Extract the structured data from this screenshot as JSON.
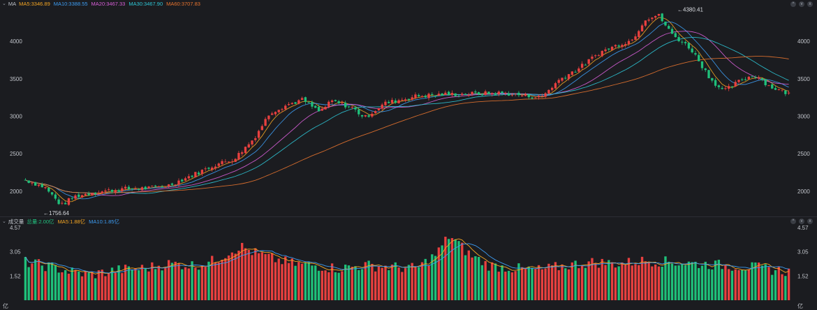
{
  "price_legend": {
    "label": "MA",
    "items": [
      {
        "text": "MA5:3346.89",
        "color": "#f5a623"
      },
      {
        "text": "MA10:3388.55",
        "color": "#3d9df3"
      },
      {
        "text": "MA20:3467.33",
        "color": "#d95fd9"
      },
      {
        "text": "MA30:3467.90",
        "color": "#2ec7d6"
      },
      {
        "text": "MA60:3707.83",
        "color": "#e8742f"
      }
    ]
  },
  "volume_legend": {
    "label": "成交量",
    "items": [
      {
        "text": "总量:2.00亿",
        "color": "#22c07e"
      },
      {
        "text": "MA5:1.88亿",
        "color": "#f5a623"
      },
      {
        "text": "MA10:1.85亿",
        "color": "#3d9df3"
      }
    ]
  },
  "controls": {
    "up_icon": "^",
    "down_icon": "v",
    "close_icon": "x"
  },
  "colors": {
    "up": "#e8403f",
    "down": "#1fc07a"
  },
  "chart_data": [
    {
      "type": "candlestick",
      "ylim": [
        1700,
        4420
      ],
      "y_ticks": [
        2000,
        2500,
        3000,
        3500,
        4000
      ],
      "y_tick_labels": [
        "2000",
        "2500",
        "3000",
        "3500",
        "4000"
      ],
      "grid": false,
      "annotations": [
        {
          "text": "←1756.64",
          "value": 1756.64,
          "position_hint": "low"
        },
        {
          "text": "←4380.41",
          "value": 4380.41,
          "position_hint": "high"
        }
      ],
      "close_path": [
        [
          0,
          2150
        ],
        [
          0.03,
          2050
        ],
        [
          0.055,
          1810
        ],
        [
          0.075,
          1930
        ],
        [
          0.11,
          1990
        ],
        [
          0.15,
          2030
        ],
        [
          0.19,
          2040
        ],
        [
          0.22,
          2080
        ],
        [
          0.26,
          2230
        ],
        [
          0.29,
          2350
        ],
        [
          0.32,
          2430
        ],
        [
          0.35,
          2700
        ],
        [
          0.375,
          3050
        ],
        [
          0.4,
          3150
        ],
        [
          0.425,
          3220
        ],
        [
          0.45,
          3060
        ],
        [
          0.47,
          3200
        ],
        [
          0.5,
          3120
        ],
        [
          0.52,
          2980
        ],
        [
          0.55,
          3170
        ],
        [
          0.6,
          3270
        ],
        [
          0.64,
          3290
        ],
        [
          0.69,
          3300
        ],
        [
          0.73,
          3310
        ],
        [
          0.76,
          3280
        ],
        [
          0.79,
          3250
        ],
        [
          0.82,
          3500
        ],
        [
          0.85,
          3650
        ],
        [
          0.88,
          3850
        ],
        [
          0.91,
          3960
        ],
        [
          0.93,
          4020
        ],
        [
          0.95,
          4300
        ],
        [
          0.97,
          4350
        ],
        [
          0.99,
          4100
        ],
        [
          1.02,
          3900
        ],
        [
          1.05,
          3500
        ],
        [
          1.07,
          3330
        ],
        [
          1.1,
          3500
        ],
        [
          1.12,
          3550
        ],
        [
          1.14,
          3400
        ],
        [
          1.17,
          3300
        ]
      ],
      "series": [
        {
          "name": "MA5",
          "value": 3346.89
        },
        {
          "name": "MA10",
          "value": 3388.55
        },
        {
          "name": "MA20",
          "value": 3467.33
        },
        {
          "name": "MA30",
          "value": 3467.9
        },
        {
          "name": "MA60",
          "value": 3707.83
        }
      ]
    },
    {
      "type": "bar",
      "ylim": [
        0,
        4.57
      ],
      "y_ticks": [
        1.52,
        3.05,
        4.57
      ],
      "y_tick_labels": [
        "1.52",
        "3.05",
        "4.57"
      ],
      "unit_label": "亿",
      "volume_path": [
        [
          0,
          2.4
        ],
        [
          0.04,
          2.1
        ],
        [
          0.07,
          1.8
        ],
        [
          0.1,
          1.6
        ],
        [
          0.14,
          1.9
        ],
        [
          0.18,
          2.0
        ],
        [
          0.22,
          2.3
        ],
        [
          0.26,
          2.2
        ],
        [
          0.29,
          2.5
        ],
        [
          0.31,
          3.0
        ],
        [
          0.33,
          3.4
        ],
        [
          0.35,
          3.0
        ],
        [
          0.38,
          2.6
        ],
        [
          0.41,
          2.3
        ],
        [
          0.44,
          2.2
        ],
        [
          0.48,
          2.0
        ],
        [
          0.52,
          2.2
        ],
        [
          0.56,
          2.1
        ],
        [
          0.6,
          2.0
        ],
        [
          0.63,
          2.9
        ],
        [
          0.65,
          4.1
        ],
        [
          0.68,
          2.9
        ],
        [
          0.71,
          2.2
        ],
        [
          0.75,
          2.0
        ],
        [
          0.79,
          1.9
        ],
        [
          0.83,
          2.2
        ],
        [
          0.87,
          2.4
        ],
        [
          0.91,
          2.3
        ],
        [
          0.95,
          2.5
        ],
        [
          0.99,
          2.4
        ],
        [
          1.03,
          2.3
        ],
        [
          1.07,
          2.2
        ],
        [
          1.11,
          2.1
        ],
        [
          1.15,
          1.9
        ],
        [
          1.17,
          1.8
        ]
      ]
    }
  ]
}
